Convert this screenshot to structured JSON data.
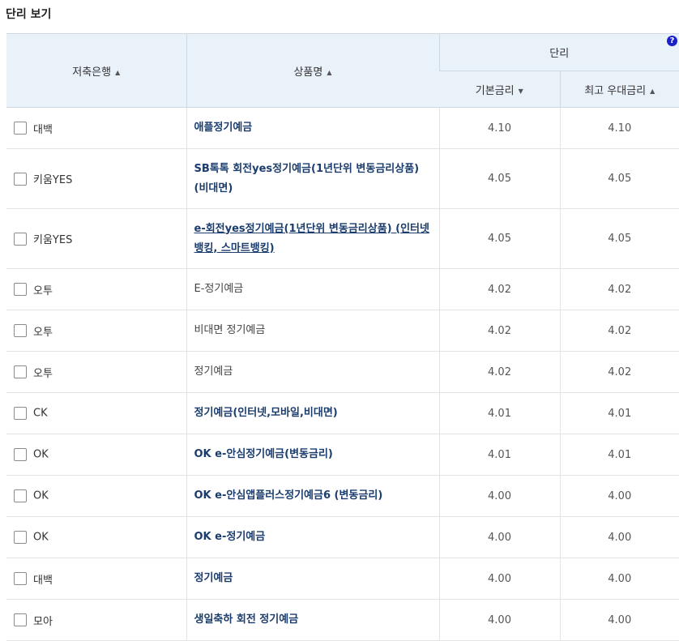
{
  "section_title": "단리 보기",
  "header": {
    "bank_col": "저축은행",
    "product_col": "상품명",
    "rate_group": "단리",
    "base_rate_col": "기본금리",
    "max_rate_col": "최고 우대금리",
    "sort_up": "▲",
    "sort_down": "▼",
    "help": "?"
  },
  "rows": [
    {
      "bank": "대백",
      "product": "애플정기예금",
      "base": "4.10",
      "max": "4.10"
    },
    {
      "bank": "키움YES",
      "product": "SB톡톡 회전yes정기예금(1년단위 변동금리상품)(비대면)",
      "base": "4.05",
      "max": "4.05"
    },
    {
      "bank": "키움YES",
      "product": "e-회전yes정기예금(1년단위 변동금리상품) (인터넷뱅킹, 스마트뱅킹)",
      "base": "4.05",
      "max": "4.05"
    },
    {
      "bank": "오투",
      "product": "E-정기예금",
      "base": "4.02",
      "max": "4.02"
    },
    {
      "bank": "오투",
      "product": "비대면 정기예금",
      "base": "4.02",
      "max": "4.02"
    },
    {
      "bank": "오투",
      "product": "정기예금",
      "base": "4.02",
      "max": "4.02"
    },
    {
      "bank": "CK",
      "product": "정기예금(인터넷,모바일,비대면)",
      "base": "4.01",
      "max": "4.01"
    },
    {
      "bank": "OK",
      "product": "OK e-안심정기예금(변동금리)",
      "base": "4.01",
      "max": "4.01"
    },
    {
      "bank": "OK",
      "product": "OK e-안심앱플러스정기예금6 (변동금리)",
      "base": "4.00",
      "max": "4.00"
    },
    {
      "bank": "OK",
      "product": "OK e-정기예금",
      "base": "4.00",
      "max": "4.00"
    },
    {
      "bank": "대백",
      "product": "정기예금",
      "base": "4.00",
      "max": "4.00"
    },
    {
      "bank": "모아",
      "product": "생일축하 회전 정기예금",
      "base": "4.00",
      "max": "4.00"
    }
  ]
}
